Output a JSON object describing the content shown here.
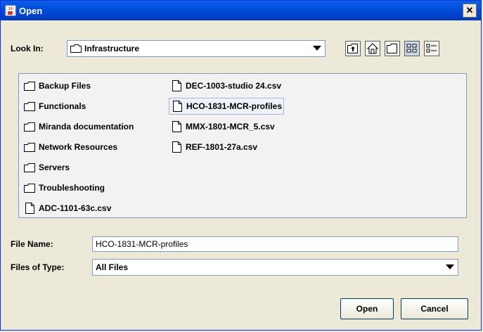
{
  "window": {
    "title": "Open"
  },
  "look_in": {
    "label": "Look In:",
    "value": "Infrastructure"
  },
  "toolbar": {
    "icons": [
      "up-one-level-icon",
      "home-icon",
      "new-folder-icon",
      "list-view-icon",
      "details-view-icon"
    ]
  },
  "files": {
    "col1": [
      "Backup Files",
      "Functionals",
      "Miranda documentation",
      "Network Resources",
      "Servers",
      "Troubleshooting",
      "ADC-1101-63c.csv"
    ],
    "col2": [
      "DEC-1003-studio 24.csv",
      "HCO-1831-MCR-profiles",
      "MMX-1801-MCR_5.csv",
      "REF-1801-27a.csv"
    ],
    "selected": "HCO-1831-MCR-profiles"
  },
  "file_name": {
    "label": "File Name:",
    "value": "HCO-1831-MCR-profiles"
  },
  "file_type": {
    "label": "Files of Type:",
    "value": "All Files"
  },
  "buttons": {
    "open": "Open",
    "cancel": "Cancel"
  },
  "colors": {
    "title_bar": "#0046d5",
    "accent": "#0831d9",
    "background": "#ece9d8"
  }
}
